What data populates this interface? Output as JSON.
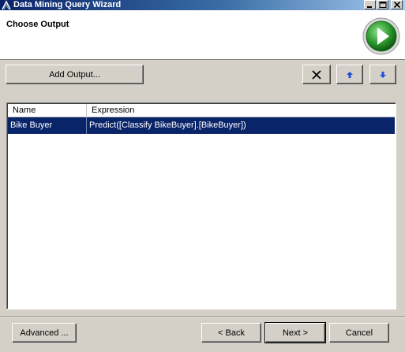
{
  "window": {
    "title": "Data Mining Query Wizard"
  },
  "header": {
    "page_title": "Choose Output"
  },
  "toolbar": {
    "add_output_label": "Add Output...",
    "delete_icon": "close-x-icon",
    "move_up_icon": "arrow-up-icon",
    "move_down_icon": "arrow-down-icon"
  },
  "grid": {
    "columns": [
      "Name",
      "Expression"
    ],
    "rows": [
      {
        "name": "Bike Buyer",
        "expression": "Predict([Classify BikeBuyer].[BikeBuyer])",
        "selected": true
      }
    ]
  },
  "footer": {
    "advanced_label": "Advanced ...",
    "back_label": "< Back",
    "next_label": "Next >",
    "cancel_label": "Cancel"
  },
  "colors": {
    "face": "#d4d0c8",
    "selection": "#0a246a",
    "wizard_green": "#2e9a2e",
    "arrow_blue": "#1f4fd6"
  }
}
